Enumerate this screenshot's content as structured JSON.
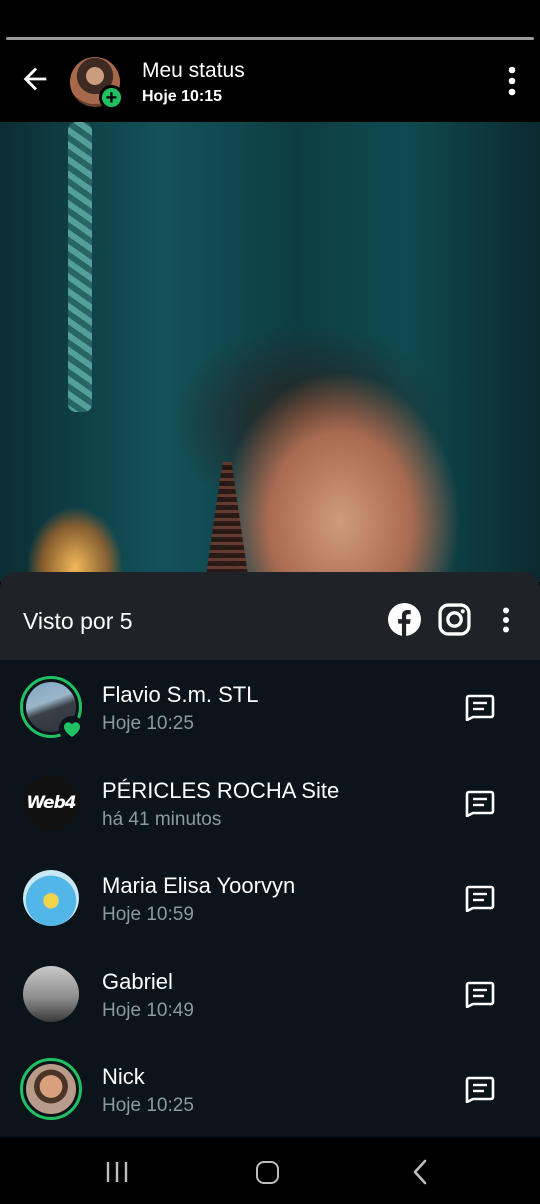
{
  "header": {
    "title": "Meu status",
    "subtitle": "Hoje 10:15"
  },
  "sheet": {
    "seen_label": "Visto por 5"
  },
  "viewers": [
    {
      "name": "Flavio S.m. STL",
      "time": "Hoje 10:25",
      "liked": true,
      "status_ring": true
    },
    {
      "name": "PÉRICLES ROCHA Site",
      "time": "há 41 minutos",
      "liked": false,
      "status_ring": false
    },
    {
      "name": "Maria Elisa Yoorvyn",
      "time": "Hoje 10:59",
      "liked": false,
      "status_ring": false
    },
    {
      "name": "Gabriel",
      "time": "Hoje 10:49",
      "liked": false,
      "status_ring": false
    },
    {
      "name": "Nick",
      "time": "Hoje 10:25",
      "liked": false,
      "status_ring": true
    }
  ],
  "avatar_logo_text": "Web4",
  "colors": {
    "accent_green": "#21c063",
    "sheet_bg": "#0b141a",
    "sheet_header_bg": "#1f2328",
    "secondary_text": "#8e989f"
  },
  "icons": [
    "back-arrow-icon",
    "plus-icon",
    "more-vert-icon",
    "facebook-icon",
    "instagram-icon",
    "message-icon",
    "heart-icon",
    "recent-apps-icon",
    "home-icon",
    "back-chevron-icon"
  ]
}
